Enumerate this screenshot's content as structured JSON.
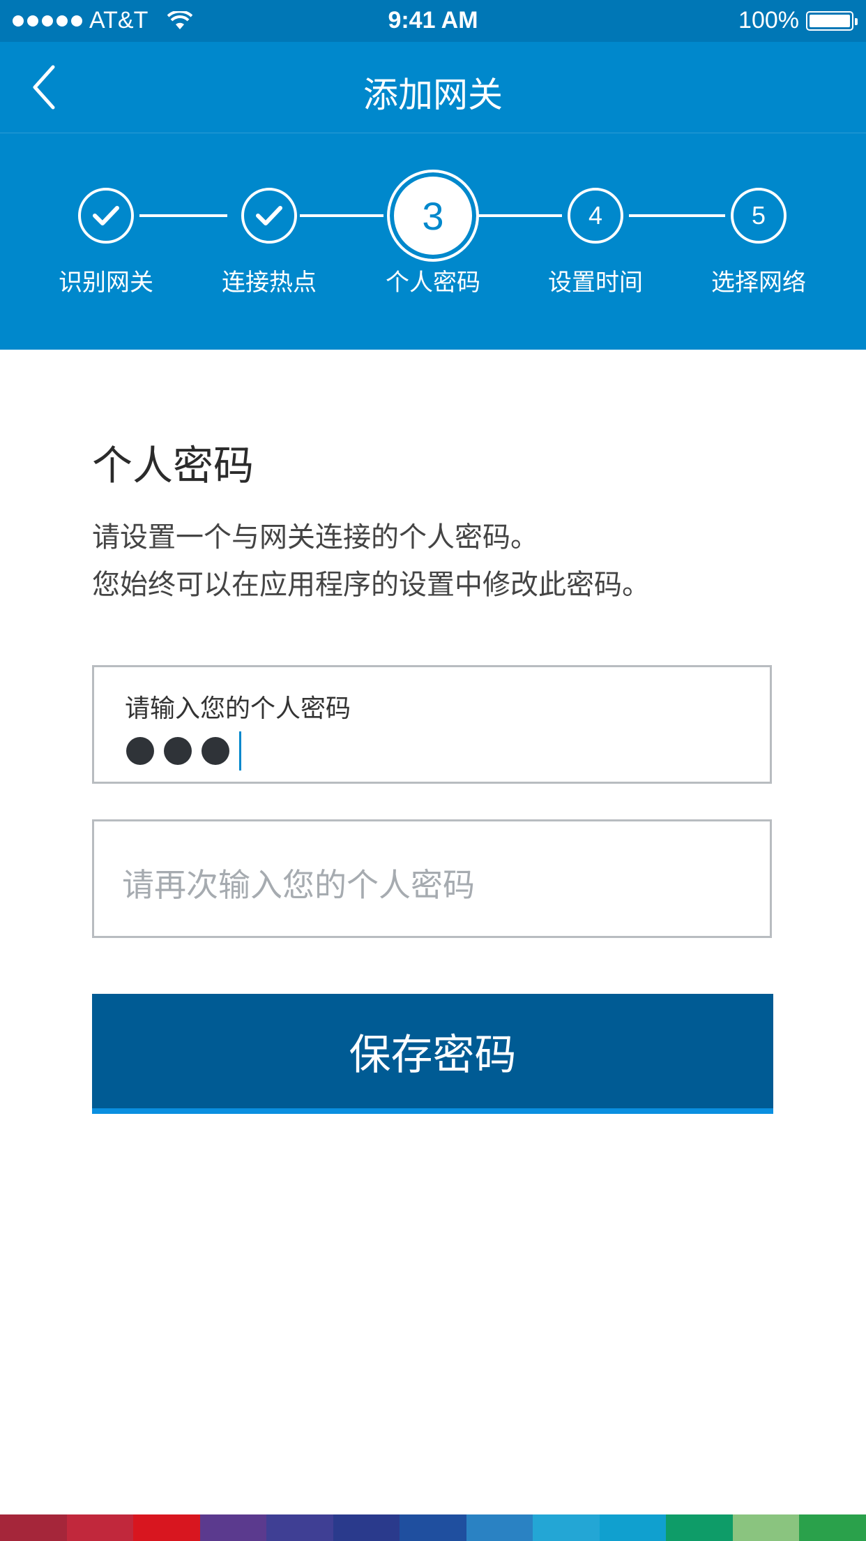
{
  "status_bar": {
    "carrier": "AT&T",
    "time": "9:41 AM",
    "battery": "100%"
  },
  "nav": {
    "title": "添加网关",
    "back_icon": "chevron-left-icon"
  },
  "stepper": {
    "steps": [
      {
        "label": "识别网关",
        "state": "done",
        "number": "1"
      },
      {
        "label": "连接热点",
        "state": "done",
        "number": "2"
      },
      {
        "label": "个人密码",
        "state": "active",
        "number": "3"
      },
      {
        "label": "设置时间",
        "state": "pending",
        "number": "4"
      },
      {
        "label": "选择网络",
        "state": "pending",
        "number": "5"
      }
    ]
  },
  "main": {
    "heading": "个人密码",
    "description_line1": "请设置一个与网关连接的个人密码。",
    "description_line2": "您始终可以在应用程序的设置中修改此密码。",
    "password_field": {
      "label": "请输入您的个人密码",
      "masked_length": 3
    },
    "confirm_field": {
      "placeholder": "请再次输入您的个人密码"
    },
    "save_button": "保存密码"
  },
  "colors": {
    "primary": "#0088cc",
    "status_bar": "#0077b6",
    "button": "#005b94",
    "footer_band": [
      "#a5263a",
      "#c1283c",
      "#d8161f",
      "#5b3a8e",
      "#3f3f94",
      "#2a3a8c",
      "#1f4f9f",
      "#2a82c3",
      "#23a6d5",
      "#10a0cf",
      "#0e9c68",
      "#8ac47f",
      "#2aa14b"
    ]
  }
}
